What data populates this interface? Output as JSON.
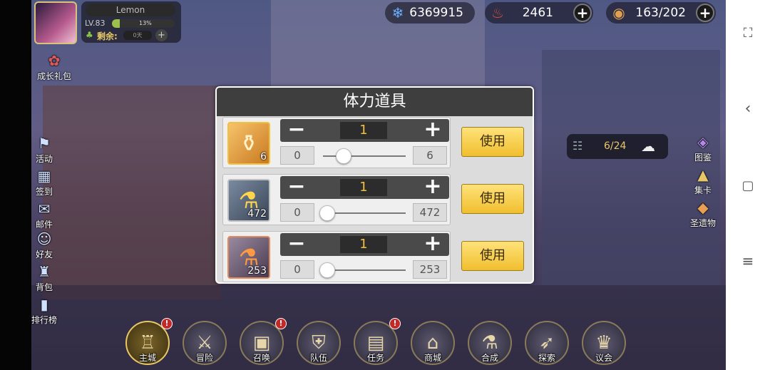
{
  "player": {
    "name": "Lemon",
    "level": "LV.83",
    "exp_percent": 13,
    "exp_text": "13%",
    "remain_label": "剩余:",
    "remain_value": "0天"
  },
  "resources": [
    {
      "icon": "crystal-icon",
      "value": "6369915"
    },
    {
      "icon": "food-icon",
      "value": "2461"
    },
    {
      "icon": "stamina-icon",
      "value": "163/202"
    }
  ],
  "left_menu": {
    "growth_pack": "成长礼包",
    "items": [
      "活动",
      "签到",
      "邮件",
      "好友",
      "背包",
      "排行榜"
    ]
  },
  "right_menu": {
    "items": [
      "图鉴",
      "集卡",
      "圣遗物"
    ]
  },
  "quest": {
    "value": "6/24"
  },
  "dialog": {
    "title": "体力道具",
    "rows": [
      {
        "item_count": "6",
        "qty": "1",
        "min": "0",
        "max": "6",
        "slider_fraction": 0.2,
        "use_label": "使用",
        "item_icon": "orange-potion-icon"
      },
      {
        "item_count": "472",
        "qty": "1",
        "min": "0",
        "max": "472",
        "slider_fraction": 0.0,
        "use_label": "使用",
        "item_icon": "yellow-vial-icon"
      },
      {
        "item_count": "253",
        "qty": "1",
        "min": "0",
        "max": "253",
        "slider_fraction": 0.0,
        "use_label": "使用",
        "item_icon": "orange-vial-icon"
      }
    ]
  },
  "bottom_menu": [
    {
      "label": "主城",
      "icon": "castle-icon",
      "badge": "!"
    },
    {
      "label": "冒险",
      "icon": "crossed-swords-icon",
      "badge": ""
    },
    {
      "label": "召唤",
      "icon": "summon-card-icon",
      "badge": "!"
    },
    {
      "label": "队伍",
      "icon": "team-shield-icon",
      "badge": ""
    },
    {
      "label": "任务",
      "icon": "quest-book-icon",
      "badge": "!"
    },
    {
      "label": "商城",
      "icon": "shop-icon",
      "badge": ""
    },
    {
      "label": "合成",
      "icon": "flask-icon",
      "badge": ""
    },
    {
      "label": "探索",
      "icon": "bow-icon",
      "badge": ""
    },
    {
      "label": "议会",
      "icon": "council-icon",
      "badge": ""
    }
  ],
  "colors": {
    "accent": "#e8c766",
    "use_button": "#f0bf2e",
    "dialog_header": "#3e3e3e"
  }
}
